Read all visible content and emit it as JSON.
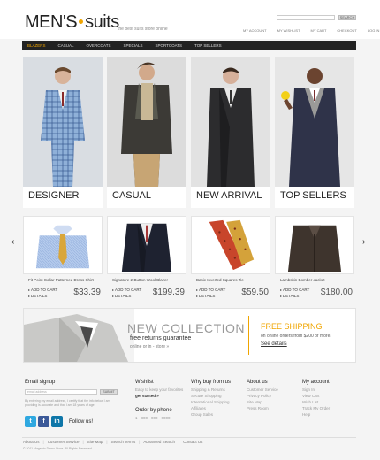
{
  "header": {
    "logo_main": "MEN'S",
    "logo_sub": "suits",
    "tagline": "the best suits store online",
    "search_placeholder": "",
    "search_button": "SEARCH",
    "top_links": [
      "MY ACCOUNT",
      "MY WISHLIST",
      "MY CART",
      "CHECKOUT",
      "LOG IN"
    ]
  },
  "nav": {
    "items": [
      "BLAZERS",
      "CASUAL",
      "OVERCOATS",
      "SPECIALS",
      "SPORTCOATS",
      "TOP SELLERS"
    ],
    "active_index": 0
  },
  "categories": [
    {
      "label": "DESIGNER"
    },
    {
      "label": "CASUAL"
    },
    {
      "label": "NEW ARRIVAL"
    },
    {
      "label": "TOP SELLERS"
    }
  ],
  "arrows": {
    "prev": "‹",
    "next": "›"
  },
  "products": [
    {
      "name": "Fit Point Collar Patterned Dress Shirt",
      "add_to_cart": "ADD TO CART",
      "details": "DETAILS",
      "price": "$33.39"
    },
    {
      "name": "Signature 2-Button Wool Blazer",
      "add_to_cart": "ADD TO CART",
      "details": "DETAILS",
      "price": "$199.39"
    },
    {
      "name": "Basic Inverted Squares Tie",
      "add_to_cart": "ADD TO CART",
      "details": "DETAILS",
      "price": "$59.50"
    },
    {
      "name": "Lambskin Bomber Jacket",
      "add_to_cart": "ADD TO CART",
      "details": "DETAILS",
      "price": "$180.00"
    }
  ],
  "promo": {
    "collection_title": "NEW COLLECTION",
    "collection_sub": "free returns guarantee",
    "collection_sub2": "online or in - store »",
    "shipping_title": "FREE SHIPPING",
    "shipping_sub": "on online orders from $200 or more.",
    "shipping_link": "See details"
  },
  "footer": {
    "signup_title": "Email signup",
    "signup_placeholder": "email address",
    "signup_button": "SUBMIT",
    "signup_desc": "By entering my email address, I certify that the info below I am providing is accurate and that I am 18 years of age",
    "follow": "Follow us!",
    "wishlist_title": "Wishlist",
    "wishlist_text": "Easy to keep your favorites",
    "wishlist_link": "get started »",
    "order_title": "Order by phone",
    "order_phone": "1 - 800 - 000 - 0000",
    "why_title": "Why buy from us",
    "why_links": [
      "Shipping & Returns",
      "Secure Shopping",
      "International Shipping",
      "Affiliates",
      "Group Sales"
    ],
    "about_title": "About us",
    "about_links": [
      "Customer Service",
      "Privacy Policy",
      "Site Map",
      "Press Room"
    ],
    "account_title": "My account",
    "account_links": [
      "Sign In",
      "View Cart",
      "Wish List",
      "Track My Order",
      "Help"
    ],
    "bottom_links": [
      "About Us",
      "Customer Service",
      "Site Map",
      "Search Terms",
      "Advanced Search",
      "Contact Us"
    ],
    "copyright": "© 2011 Magento Demo Store. All Rights Reserved."
  },
  "colors": {
    "accent": "#f0a500",
    "nav_bg": "#222222"
  }
}
